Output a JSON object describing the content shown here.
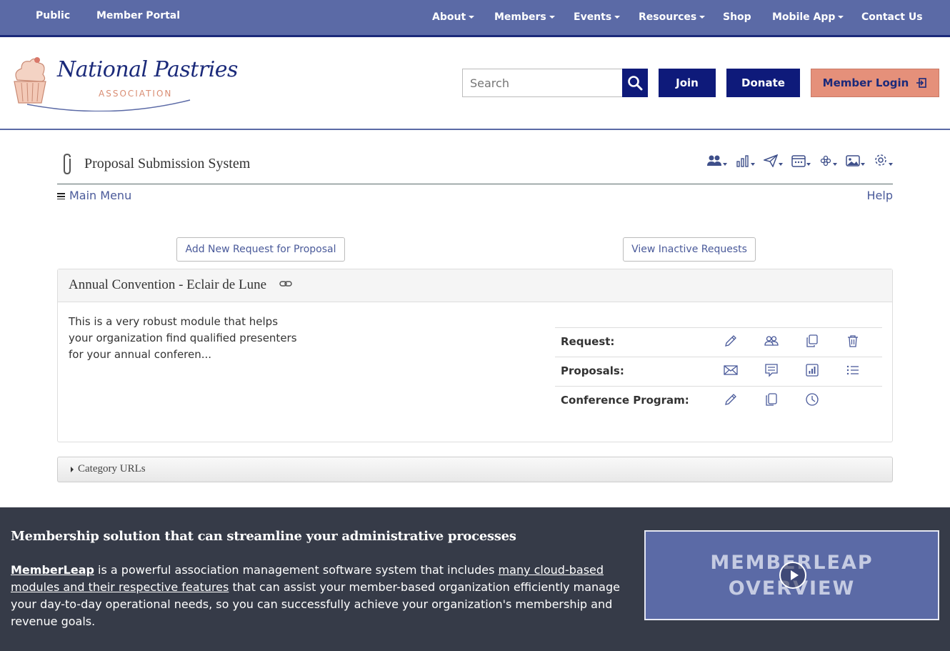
{
  "topnav": {
    "left": [
      "Public",
      "Member Portal"
    ],
    "right": [
      {
        "label": "About",
        "dropdown": true
      },
      {
        "label": "Members",
        "dropdown": true
      },
      {
        "label": "Events",
        "dropdown": true
      },
      {
        "label": "Resources",
        "dropdown": true
      },
      {
        "label": "Shop",
        "dropdown": false
      },
      {
        "label": "Mobile App",
        "dropdown": true
      },
      {
        "label": "Contact Us",
        "dropdown": false
      }
    ]
  },
  "header": {
    "logo_title": "National Pastries",
    "logo_subtitle": "ASSOCIATION",
    "search_placeholder": "Search",
    "join_label": "Join",
    "donate_label": "Donate",
    "login_label": "Member Login"
  },
  "module": {
    "title": "Proposal Submission System",
    "main_menu": "Main Menu",
    "help": "Help",
    "add_button": "Add New Request for Proposal",
    "inactive_button": "View Inactive Requests",
    "toolbar_icons": [
      "people-icon",
      "chart-icon",
      "send-icon",
      "calendar-icon",
      "snowflake-icon",
      "image-icon",
      "gear-icon"
    ]
  },
  "panel": {
    "title": "Annual Convention - Eclair de Lune",
    "description": "This is a very robust module that helps your organization find qualified presenters for your annual conferen...",
    "rows": [
      {
        "label": "Request:",
        "icons": [
          "pencil-icon",
          "people-icon",
          "copy-icon",
          "trash-icon"
        ]
      },
      {
        "label": "Proposals:",
        "icons": [
          "envelope-icon",
          "comment-icon",
          "chart-icon",
          "list-icon"
        ]
      },
      {
        "label": "Conference Program:",
        "icons": [
          "pencil-icon",
          "copy-icon",
          "clock-icon"
        ]
      }
    ]
  },
  "category": {
    "label": "Category URLs"
  },
  "footer": {
    "heading": "Membership solution that can streamline your administrative processes",
    "brand": "MemberLeap",
    "text1": " is a powerful association management software system that includes ",
    "link": "many cloud-based modules and their respective features",
    "text2": " that can assist your member-based organization efficiently manage your day-to-day operational needs, so you can successfully achieve your organization's membership and revenue goals.",
    "video_line1": "MEMBERLEAP",
    "video_line2": "OVERVIEW"
  },
  "colors": {
    "nav": "#5b6aa6",
    "navy": "#0e1a7a",
    "login": "#e5907a",
    "footer": "#363b48"
  }
}
